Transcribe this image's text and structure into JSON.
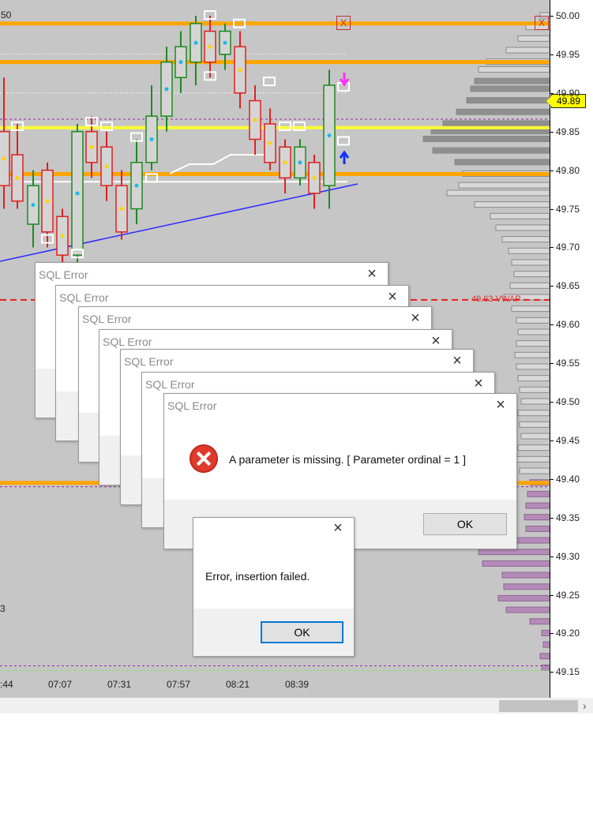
{
  "price_axis": {
    "ticks": [
      "50.00",
      "49.95",
      "49.90",
      "49.85",
      "49.80",
      "49.75",
      "49.70",
      "49.65",
      "49.60",
      "49.55",
      "49.50",
      "49.45",
      "49.40",
      "49.35",
      "49.30",
      "49.25",
      "49.20",
      "49.15"
    ],
    "last_price": "49.89"
  },
  "time_axis": {
    "labels": [
      ":44",
      "07:07",
      "07:31",
      "07:57",
      "08:21",
      "08:39"
    ]
  },
  "chart": {
    "top_left_partial_value": "50",
    "close_glyph": "X",
    "vwap_label": "49.63 VWAP",
    "left_partial_label": "3",
    "colors": {
      "background": "#c6c6c6",
      "level_orange": "#ffa500",
      "vpoc_yellow": "#ffff33",
      "vwap_red": "#e82020",
      "trendline_blue": "#2b2bff",
      "bull_green": "#1e8a1e",
      "bear_red": "#e02020",
      "profile_gray": "#8a8a8a",
      "profile_purple": "#b48ab8",
      "bottom_green": "#90e070"
    }
  },
  "sql_error_dialogs": {
    "title": "SQL Error",
    "close_glyph": "×",
    "message": "A parameter is missing. [ Parameter ordinal = 1 ]",
    "ok_label": "OK",
    "icon": "error-icon"
  },
  "insert_error_dialog": {
    "close_glyph": "×",
    "message": "Error, insertion failed.",
    "ok_label": "OK"
  },
  "scrollbar": {
    "arrow_glyph": "›"
  }
}
